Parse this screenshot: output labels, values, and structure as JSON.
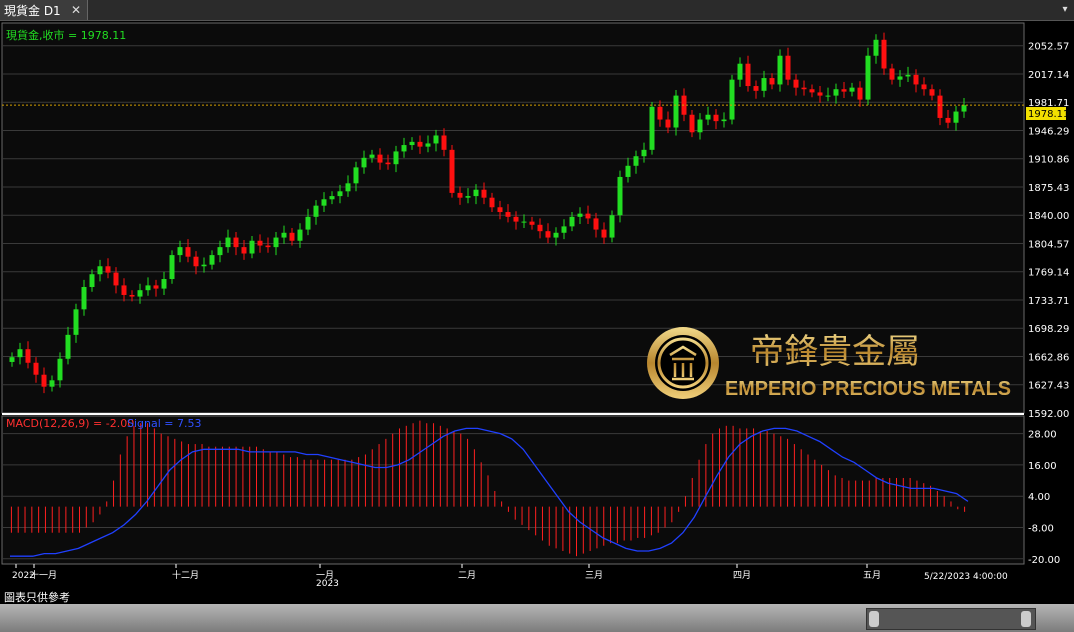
{
  "tab": {
    "title": "現貨金 D1"
  },
  "price_panel": {
    "legend": "現貨金,收市 = 1978.11",
    "current_price": "1978.11",
    "y_ticks": [
      "2052.57",
      "2017.14",
      "1981.71",
      "1946.29",
      "1910.86",
      "1875.43",
      "1840.00",
      "1804.57",
      "1769.14",
      "1733.71",
      "1698.29",
      "1662.86",
      "1627.43",
      "1592.00"
    ]
  },
  "macd_panel": {
    "legend_macd": "MACD(12,26,9) = -2.00",
    "legend_signal": "Signal = 7.53",
    "y_ticks": [
      "28.00",
      "16.00",
      "4.00",
      "-8.00",
      "-20.00"
    ]
  },
  "x_axis": {
    "labels": [
      {
        "text": "2022",
        "sub": ""
      },
      {
        "text": "十一月",
        "sub": ""
      },
      {
        "text": "十二月",
        "sub": ""
      },
      {
        "text": "一月",
        "sub": "2023"
      },
      {
        "text": "二月",
        "sub": ""
      },
      {
        "text": "三月",
        "sub": ""
      },
      {
        "text": "四月",
        "sub": ""
      },
      {
        "text": "五月",
        "sub": ""
      }
    ],
    "cursor_label": "5/22/2023 4:00:00"
  },
  "watermark": {
    "chinese": "帝鋒貴金屬",
    "english": "EMPERIO PRECIOUS METALS"
  },
  "disclaimer": "圖表只供參考",
  "colors": {
    "up": "#22dd22",
    "down": "#ff1010",
    "macd_hist": "#ff2020",
    "signal": "#2040ff",
    "grid": "#3a3a3a",
    "axis_text": "#ffffff",
    "legend_price": "#22dd22",
    "legend_macd": "#ff3030",
    "legend_signal": "#3050ff",
    "price_line": "#d4a000",
    "gold": "#c9a24a"
  },
  "chart_data": {
    "type": "candlestick",
    "price_ylim": [
      1592.0,
      2066
    ],
    "macd_ylim": [
      -22,
      34
    ],
    "candles_close_estimate": [
      1662,
      1672,
      1655,
      1640,
      1625,
      1633,
      1660,
      1690,
      1722,
      1750,
      1766,
      1776,
      1768,
      1752,
      1740,
      1738,
      1746,
      1752,
      1748,
      1760,
      1790,
      1800,
      1788,
      1776,
      1778,
      1790,
      1800,
      1812,
      1800,
      1792,
      1808,
      1802,
      1800,
      1812,
      1818,
      1808,
      1822,
      1838,
      1852,
      1860,
      1864,
      1870,
      1880,
      1900,
      1912,
      1916,
      1906,
      1904,
      1920,
      1928,
      1932,
      1926,
      1930,
      1940,
      1922,
      1868,
      1862,
      1864,
      1872,
      1862,
      1850,
      1844,
      1838,
      1832,
      1832,
      1828,
      1820,
      1812,
      1818,
      1826,
      1838,
      1842,
      1836,
      1822,
      1812,
      1840,
      1888,
      1902,
      1914,
      1922,
      1976,
      1960,
      1950,
      1990,
      1966,
      1944,
      1960,
      1966,
      1958,
      1960,
      2010,
      2030,
      2002,
      1996,
      2012,
      2004,
      2040,
      2010,
      2000,
      1998,
      1994,
      1990,
      1990,
      1998,
      1995,
      2000,
      1985,
      2040,
      2060,
      2024,
      2010,
      2014,
      2016,
      2004,
      1998,
      1990,
      1962,
      1956,
      1970,
      1978
    ],
    "macd_values": [
      -10,
      -10,
      -10,
      -10,
      -10,
      -10,
      -10,
      -10,
      -10,
      -10,
      -10,
      -8,
      -6,
      -3,
      2,
      10,
      20,
      27,
      31,
      32,
      32,
      30,
      28,
      27,
      26,
      25,
      24,
      24,
      24,
      23,
      23,
      23,
      23,
      23,
      23,
      23,
      23,
      22,
      21,
      21,
      20,
      19,
      19,
      18,
      18,
      18,
      18,
      18,
      18,
      18,
      18,
      19,
      20,
      22,
      24,
      26,
      28,
      30,
      31,
      32,
      33,
      32,
      32,
      31,
      30,
      29,
      28,
      26,
      22,
      17,
      12,
      6,
      2,
      -2,
      -5,
      -7,
      -9,
      -11,
      -13,
      -15,
      -16,
      -17,
      -18,
      -19,
      -18,
      -17,
      -16,
      -15,
      -14,
      -14,
      -13,
      -13,
      -12,
      -12,
      -11,
      -10,
      -8,
      -6,
      -2,
      4,
      11,
      18,
      24,
      28,
      30,
      31,
      31,
      30,
      30,
      30,
      29,
      29,
      28,
      27,
      26,
      24,
      22,
      20,
      18,
      16,
      14,
      12,
      11,
      10,
      10,
      10,
      10,
      11,
      11,
      11,
      11,
      11,
      11,
      10,
      9,
      8,
      6,
      4,
      2,
      -1,
      -2
    ],
    "signal_estimate": [
      -19,
      -19,
      -19,
      -18,
      -18,
      -17,
      -16,
      -14,
      -12,
      -10,
      -7,
      -3,
      2,
      8,
      14,
      18,
      21,
      22,
      22,
      22,
      22,
      21,
      21,
      21,
      21,
      21,
      20,
      20,
      19,
      18,
      17,
      16,
      15,
      15,
      16,
      18,
      21,
      24,
      27,
      29,
      30,
      30,
      29,
      28,
      26,
      22,
      16,
      10,
      4,
      -2,
      -6,
      -9,
      -12,
      -14,
      -16,
      -17,
      -17,
      -16,
      -14,
      -10,
      -4,
      4,
      12,
      19,
      24,
      27,
      29,
      30,
      30,
      29,
      27,
      25,
      22,
      19,
      17,
      14,
      11,
      9,
      8,
      7,
      7,
      7,
      6,
      5,
      2
    ]
  }
}
